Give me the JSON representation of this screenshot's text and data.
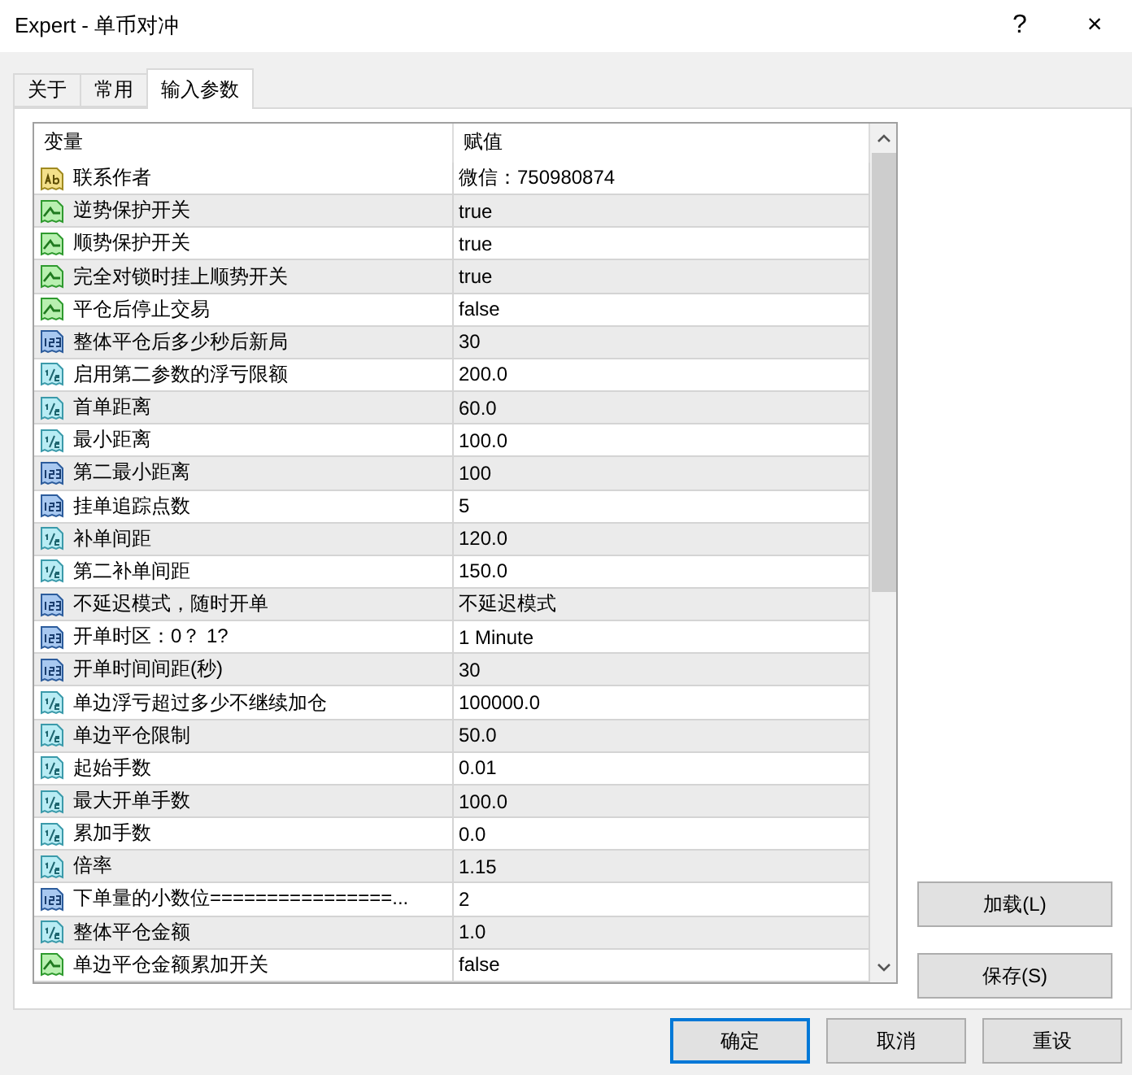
{
  "window": {
    "title": "Expert - 单币对冲",
    "help": "?",
    "close": "×"
  },
  "tabs": [
    {
      "label": "关于",
      "selected": false
    },
    {
      "label": "常用",
      "selected": false
    },
    {
      "label": "输入参数",
      "selected": true
    }
  ],
  "table": {
    "columns": [
      "变量",
      "赋值"
    ],
    "rows": [
      {
        "kind": "text",
        "name": "联系作者",
        "value": "微信：750980874"
      },
      {
        "kind": "bool",
        "name": "逆势保护开关",
        "value": "true"
      },
      {
        "kind": "bool",
        "name": "顺势保护开关",
        "value": "true"
      },
      {
        "kind": "bool",
        "name": "完全对锁时挂上顺势开关",
        "value": "true"
      },
      {
        "kind": "bool",
        "name": "平仓后停止交易",
        "value": "false"
      },
      {
        "kind": "int",
        "name": "整体平仓后多少秒后新局",
        "value": "30"
      },
      {
        "kind": "double",
        "name": "启用第二参数的浮亏限额",
        "value": "200.0"
      },
      {
        "kind": "double",
        "name": "首单距离",
        "value": "60.0"
      },
      {
        "kind": "double",
        "name": "最小距离",
        "value": "100.0"
      },
      {
        "kind": "int",
        "name": "第二最小距离",
        "value": "100"
      },
      {
        "kind": "int",
        "name": "挂单追踪点数",
        "value": "5"
      },
      {
        "kind": "double",
        "name": "补单间距",
        "value": "120.0"
      },
      {
        "kind": "double",
        "name": "第二补单间距",
        "value": "150.0"
      },
      {
        "kind": "int",
        "name": "不延迟模式，随时开单",
        "value": "不延迟模式"
      },
      {
        "kind": "int",
        "name": "开单时区：0？ 1?",
        "value": "1 Minute"
      },
      {
        "kind": "int",
        "name": "开单时间间距(秒)",
        "value": "30"
      },
      {
        "kind": "double",
        "name": "单边浮亏超过多少不继续加仓",
        "value": "100000.0"
      },
      {
        "kind": "double",
        "name": "单边平仓限制",
        "value": "50.0"
      },
      {
        "kind": "double",
        "name": "起始手数",
        "value": "0.01"
      },
      {
        "kind": "double",
        "name": "最大开单手数",
        "value": "100.0"
      },
      {
        "kind": "double",
        "name": "累加手数",
        "value": "0.0"
      },
      {
        "kind": "double",
        "name": "倍率",
        "value": "1.15"
      },
      {
        "kind": "int",
        "name": "下单量的小数位================...",
        "value": "2"
      },
      {
        "kind": "double",
        "name": "整体平仓金额",
        "value": "1.0"
      },
      {
        "kind": "bool",
        "name": "单边平仓金额累加开关",
        "value": "false"
      }
    ]
  },
  "side_buttons": [
    "加载(L)",
    "保存(S)"
  ],
  "buttons": [
    {
      "label": "确定",
      "default": true
    },
    {
      "label": "取消",
      "default": false
    },
    {
      "label": "重设",
      "default": false
    }
  ]
}
